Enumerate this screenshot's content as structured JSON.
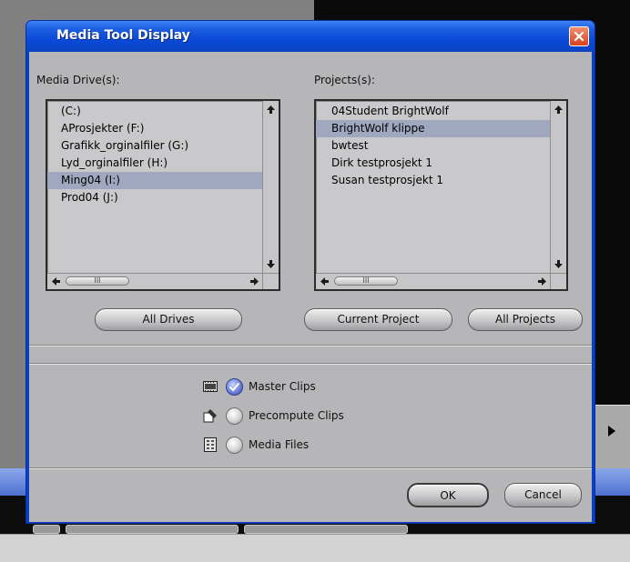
{
  "dialog": {
    "title": "Media Tool Display"
  },
  "drives": {
    "label": "Media Drive(s):",
    "items": [
      {
        "label": "(C:)",
        "selected": false
      },
      {
        "label": "AProsjekter (F:)",
        "selected": false
      },
      {
        "label": "Grafikk_orginalfiler (G:)",
        "selected": false
      },
      {
        "label": "Lyd_orginalfiler (H:)",
        "selected": false
      },
      {
        "label": "Ming04 (I:)",
        "selected": true
      },
      {
        "label": "Prod04 (J:)",
        "selected": false
      }
    ],
    "all_button": "All Drives"
  },
  "projects": {
    "label": "Projects(s):",
    "items": [
      {
        "label": "04Student BrightWolf",
        "selected": false
      },
      {
        "label": "BrightWolf klippe",
        "selected": true
      },
      {
        "label": "bwtest",
        "selected": false
      },
      {
        "label": "Dirk testprosjekt 1",
        "selected": false
      },
      {
        "label": "Susan testprosjekt 1",
        "selected": false
      }
    ],
    "current_button": "Current Project",
    "all_button": "All Projects"
  },
  "scrollbar": {
    "thumb_grip": "III"
  },
  "options": [
    {
      "label": "Master Clips",
      "icon": "film-strip-icon",
      "checked": true
    },
    {
      "label": "Precompute Clips",
      "icon": "precompute-icon",
      "checked": false
    },
    {
      "label": "Media Files",
      "icon": "media-file-icon",
      "checked": false
    }
  ],
  "footer": {
    "ok": "OK",
    "cancel": "Cancel"
  },
  "colors": {
    "title_bar": "#0b4ad8",
    "dialog_body": "#b6b6b8",
    "selection": "#a0a8bf"
  }
}
